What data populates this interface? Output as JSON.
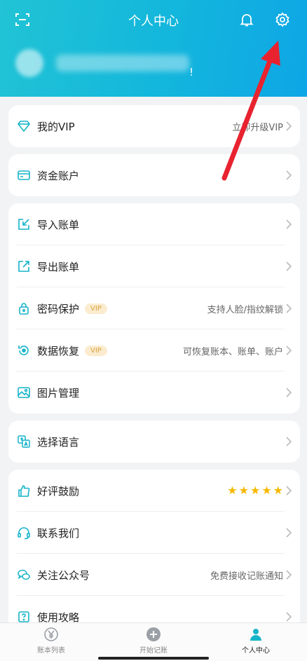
{
  "header": {
    "title": "个人中心",
    "excl": "!"
  },
  "vip": {
    "label": "我的VIP",
    "right": "立即升级VIP"
  },
  "funds": {
    "label": "资金账户"
  },
  "group3": [
    {
      "label": "导入账单",
      "icon": "import-bill-icon"
    },
    {
      "label": "导出账单",
      "icon": "export-bill-icon"
    },
    {
      "label": "密码保护",
      "icon": "lock-icon",
      "tag": "VIP",
      "right": "支持人脸/指纹解锁"
    },
    {
      "label": "数据恢复",
      "icon": "restore-icon",
      "tag": "VIP",
      "right": "可恢复账本、账单、账户"
    },
    {
      "label": "图片管理",
      "icon": "image-icon"
    }
  ],
  "language": {
    "label": "选择语言"
  },
  "group5": [
    {
      "label": "好评鼓励",
      "icon": "thumbs-up-icon",
      "rating": 5
    },
    {
      "label": "联系我们",
      "icon": "headset-icon"
    },
    {
      "label": "关注公众号",
      "icon": "wechat-icon",
      "right": "免费接收记账通知"
    },
    {
      "label": "使用攻略",
      "icon": "help-icon"
    }
  ],
  "tabs": [
    {
      "label": "账本列表"
    },
    {
      "label": "开始记账"
    },
    {
      "label": "个人中心"
    }
  ],
  "colors": {
    "header_start": "#21c3d5",
    "header_end": "#0ea6e6",
    "accent": "#16b4c9",
    "vip_tag": "#d9a441",
    "star": "#f6b800",
    "arrow": "#e8232f"
  }
}
